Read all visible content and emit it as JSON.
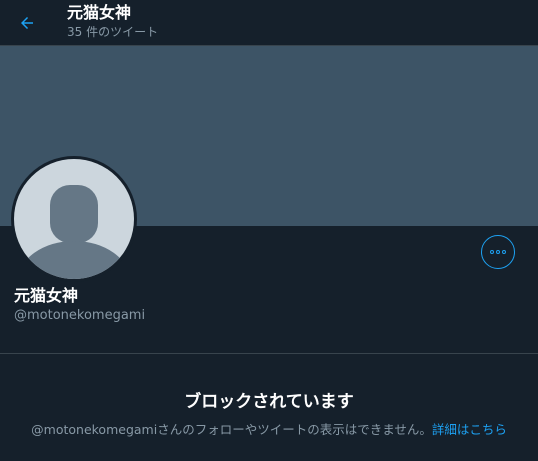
{
  "header": {
    "title": "元猫女神",
    "tweet_count": "35 件のツイート",
    "back_icon": "arrow-left-icon"
  },
  "profile": {
    "display_name": "元猫女神",
    "handle": "@motonekomegami",
    "more_icon": "more-options-icon"
  },
  "blocked": {
    "title": "ブロックされています",
    "message": "@motonekomegamiさんのフォローやツイートの表示はできません。",
    "link": "詳細はこちら"
  },
  "colors": {
    "background": "#15202b",
    "banner": "#3d5466",
    "accent": "#1da1f2",
    "secondary_text": "#8899a6",
    "border": "#38444d",
    "avatar_bg": "#ccd6dd",
    "avatar_silhouette": "#657786"
  }
}
